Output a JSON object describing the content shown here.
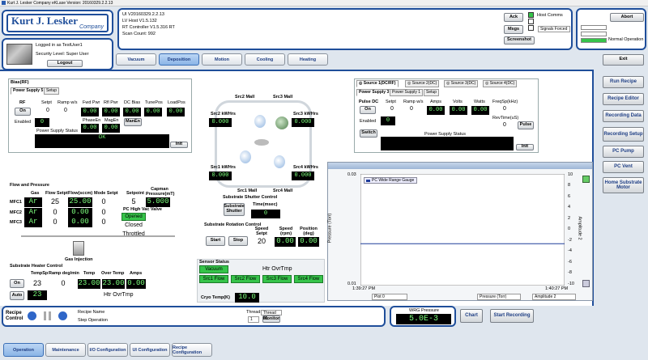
{
  "window": {
    "title": "Kurt J. Lesker Company eKLase Version: 20160329.2.2.13"
  },
  "logo": {
    "name": "Kurt J. Lesker",
    "sub": "Company"
  },
  "user": {
    "logged_in": "Logged in as TestUser1",
    "security": "Security Level: Super User",
    "logout": "Logout"
  },
  "versions": {
    "ui": "UI V20160329.2.2.13",
    "lv": "LV Host V1.5.132",
    "rt": "RT Controller V1.5.316 RT",
    "scan": "Scan Count: 992"
  },
  "comms": {
    "ack": "Ack",
    "msgs": "Msgs",
    "screenshot": "Screenshot",
    "host_comms": "Host Comms",
    "signals_forced": "Signals Forced"
  },
  "alarm": {
    "abort": "Abort",
    "normal": "Normal Operation",
    "exit": "Exit"
  },
  "tabs": [
    "Vacuum",
    "Deposition",
    "Motion",
    "Cooling",
    "Heating"
  ],
  "right_menu": [
    "Run Recipe",
    "Recipe Editor",
    "Recording Data",
    "Recording Setup",
    "PC Pump",
    "PC Vent",
    "Home Substrate Motor"
  ],
  "bottom_nav": [
    "Operation",
    "Maintenance",
    "I/O Configuration",
    "UI Configuration",
    "Recipe Configuration"
  ],
  "bias": {
    "title": "Bias(RF)",
    "tabs": [
      "Power Supply 5",
      "Setup"
    ],
    "rf": "RF",
    "on": "On",
    "enabled": "Enabled",
    "headers": [
      "Setpt",
      "Ramp w/s",
      "Fwd Pwr",
      "Rfl Pwr",
      "DC Bias",
      "TunePos",
      "LoadPos"
    ],
    "setpt": "0",
    "ramp": "0",
    "fwd": "0.00",
    "rfl": "0.00",
    "dcbias": "0.00",
    "tune": "0.00",
    "load": "0.00",
    "zero": "0",
    "phase_label": "PhaseEn",
    "mag_label": "MagEn",
    "phase": "0.00",
    "mag": "0.00",
    "man_en": "ManEn",
    "status_label": "Power Supply Status",
    "status": "OK",
    "init": "Init"
  },
  "source": {
    "tabs": [
      "Source 1(DC/RF)",
      "Source 2(DC)",
      "Source 3(DC)",
      "Source 4(DC)"
    ],
    "ps_tabs": [
      "Power Supply 3",
      "Power Supply 1",
      "Setup"
    ],
    "pulse_dc": "Pulse DC",
    "on": "On",
    "enabled": "Enabled",
    "switch": "Switch",
    "headers": [
      "Setpt",
      "Ramp w/s",
      "Amps",
      "Volts",
      "Watts"
    ],
    "freq_label": "FreqSp(kHz)",
    "rev_label": "RevTime(uS)",
    "setpt": "0",
    "ramp": "0",
    "amps": "0.00",
    "volts": "0.00",
    "watts": "0.00",
    "freq": "0",
    "rev": "0",
    "zero": "0",
    "pulse": "Pulse",
    "status_label": "Power Supply Status",
    "init": "Init"
  },
  "chamber": {
    "src2_mall": "Src2 Mall",
    "src3_mall": "Src3 Mall",
    "src1_mall": "Src1 Mall",
    "src4_mall": "Src4 Mall",
    "src2_kw": "Src2 kWHrs",
    "src3_kw": "Src3 kWHrs",
    "src1_kw": "Src1 kWHrs",
    "src4_kw": "Src4 kWHrs",
    "v2": "0.000",
    "v3": "0.000",
    "v1": "0.000",
    "v4": "0.000"
  },
  "flow": {
    "title": "Flow and Pressure",
    "headers": [
      "Gas",
      "Flow Setpt",
      "Flow(sccm)",
      "Mode Setpt"
    ],
    "rows": [
      {
        "mfc": "MFC1",
        "gas": "Ar",
        "setpt": "25",
        "flow": "25.00",
        "mode": "0"
      },
      {
        "mfc": "MFC2",
        "gas": "Ar",
        "setpt": "0",
        "flow": "0.00",
        "mode": "0"
      },
      {
        "mfc": "MFC3",
        "gas": "Ar",
        "setpt": "0",
        "flow": "0.00",
        "mode": "0"
      }
    ],
    "setpoint_label": "Setpoint",
    "capman_label": "Capman Pressure(mT)",
    "setpoint": "5",
    "capman": "5.000",
    "valve_label": "PC High Vac Valve",
    "opened": "Opened",
    "closed": "Closed",
    "throttled": "Throttled",
    "gas_injection": "Gas Injection"
  },
  "heater": {
    "title": "Substrate Heater Control",
    "headers": [
      "TempSp",
      "Ramp deg/min",
      "Temp",
      "Over Temp",
      "Amps"
    ],
    "on": "On",
    "auto": "Auto",
    "tempsp": "23",
    "ramp": "0",
    "temp": "23.00",
    "overtemp": "23.00",
    "amps": "0.00",
    "auto_val": "23",
    "htr": "Htr OvrTmp"
  },
  "shutter": {
    "title": "Substrate Shutter Control",
    "button": "Substrate Shutter",
    "time_label": "Time(msec)",
    "time": "0"
  },
  "rotation": {
    "title": "Substrate Rotation Control",
    "headers": [
      "Speed Setpt",
      "Speed (rpm)",
      "Position (deg)"
    ],
    "start": "Start",
    "stop": "Stop",
    "setpt": "20",
    "speed": "0.00",
    "position": "0.00"
  },
  "sensor": {
    "title": "Sensor Status",
    "vacuum": "Vacuum",
    "htr": "Htr OvrTmp",
    "flows": [
      "Src1 Flow",
      "Src2 Flow",
      "Src3 Flow",
      "Src4 Flow"
    ],
    "cryo_label": "Cryo Temp(K)",
    "cryo": "10.0"
  },
  "graph": {
    "legend": "PC Wide Range Gauge",
    "y_label": "Pressure (Torr)",
    "y2_label": "Amplitude 2",
    "y_top": "0.03",
    "y_bottom": "0.01",
    "x_left": "1:39:27 PM",
    "x_right": "1:40:27 PM",
    "plot_label": "Plot 0",
    "ch1": "Pressure (Torr)",
    "ch2": "Amplitude 2",
    "r_ticks": [
      "10",
      "8",
      "6",
      "4",
      "2",
      "0",
      "-2",
      "-4",
      "-6",
      "-8",
      "-10"
    ],
    "line_value": 0.0175,
    "ylim": [
      0.01,
      0.03
    ]
  },
  "recipe": {
    "title": "Recipe Control",
    "name_label": "Recipe Name",
    "step_label": "Step Operation",
    "thread_label": "Thread",
    "thread": "Thread 01",
    "thread_val": "1",
    "monitor": "Monitor"
  },
  "wrg": {
    "label": "WRG Pressure",
    "value": "5.0E-3",
    "chart": "Chart",
    "start_recording": "Start Recording"
  },
  "colors": {
    "frame": "#1f4e9a",
    "green": "#36c44a",
    "lcd": "#7dff7d"
  }
}
